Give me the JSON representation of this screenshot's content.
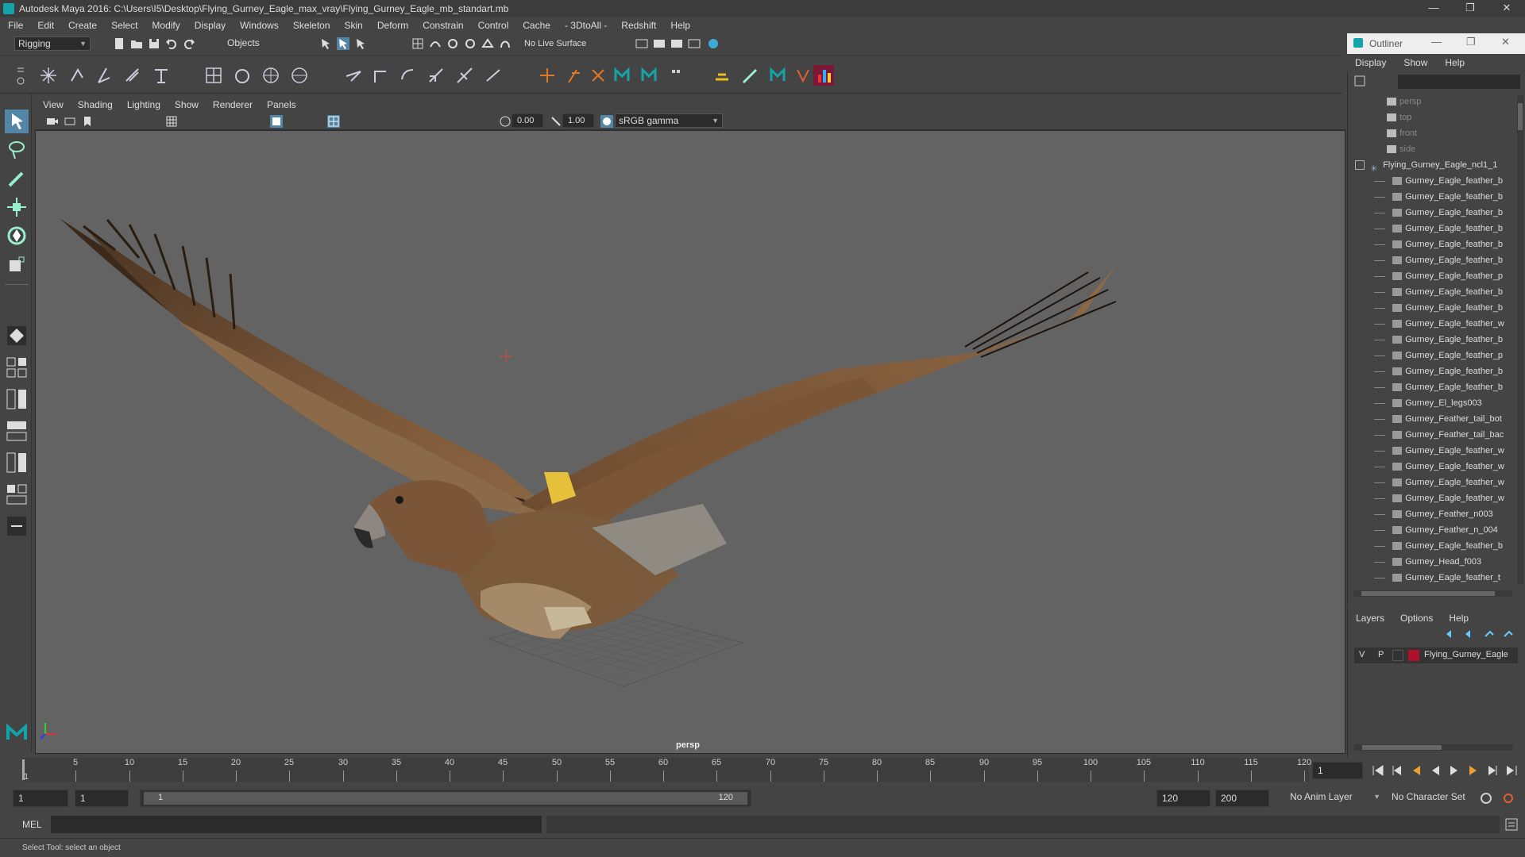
{
  "window": {
    "title": "Autodesk Maya 2016: C:\\Users\\I5\\Desktop\\Flying_Gurney_Eagle_max_vray\\Flying_Gurney_Eagle_mb_standart.mb",
    "minimize": "—",
    "restore": "❐",
    "close": "✕"
  },
  "menubar": [
    "File",
    "Edit",
    "Create",
    "Select",
    "Modify",
    "Display",
    "Windows",
    "Skeleton",
    "Skin",
    "Deform",
    "Constrain",
    "Control",
    "Cache",
    "- 3DtoAll -",
    "Redshift",
    "Help"
  ],
  "statusline": {
    "menuset": "Rigging",
    "selection_mode": "Objects",
    "live_surface": "No Live Surface"
  },
  "viewport": {
    "menus": [
      "View",
      "Shading",
      "Lighting",
      "Show",
      "Renderer",
      "Panels"
    ],
    "exposure": "0.00",
    "gamma": "1.00",
    "color_space": "sRGB gamma",
    "camera_label": "persp"
  },
  "timeline": {
    "ticks": [
      "5",
      "10",
      "15",
      "20",
      "25",
      "30",
      "35",
      "40",
      "45",
      "50",
      "55",
      "60",
      "65",
      "70",
      "75",
      "80",
      "85",
      "90",
      "95",
      "100",
      "105",
      "110",
      "115",
      "120"
    ],
    "first_tick": "1",
    "current_frame": "1"
  },
  "range": {
    "start": "1",
    "anim_start": "1",
    "slider_start": "1",
    "slider_end": "120",
    "end": "120",
    "anim_end": "200",
    "anim_layer": "No Anim Layer",
    "character_set": "No Character Set"
  },
  "cmdline": {
    "label": "MEL"
  },
  "helpline": {
    "text": "Select Tool: select an object"
  },
  "outliner": {
    "title": "Outliner",
    "menus": [
      "Display",
      "Show",
      "Help"
    ],
    "cameras": [
      "persp",
      "top",
      "front",
      "side"
    ],
    "group": "Flying_Gurney_Eagle_ncl1_1",
    "children": [
      "Gurney_Eagle_feather_b",
      "Gurney_Eagle_feather_b",
      "Gurney_Eagle_feather_b",
      "Gurney_Eagle_feather_b",
      "Gurney_Eagle_feather_b",
      "Gurney_Eagle_feather_b",
      "Gurney_Eagle_feather_p",
      "Gurney_Eagle_feather_b",
      "Gurney_Eagle_feather_b",
      "Gurney_Eagle_feather_w",
      "Gurney_Eagle_feather_b",
      "Gurney_Eagle_feather_p",
      "Gurney_Eagle_feather_b",
      "Gurney_Eagle_feather_b",
      "Gurney_El_legs003",
      "Gurney_Feather_tail_bot",
      "Gurney_Feather_tail_bac",
      "Gurney_Eagle_feather_w",
      "Gurney_Eagle_feather_w",
      "Gurney_Eagle_feather_w",
      "Gurney_Eagle_feather_w",
      "Gurney_Feather_n003",
      "Gurney_Feather_n_004",
      "Gurney_Eagle_feather_b",
      "Gurney_Head_f003",
      "Gurney_Eagle_feather_t"
    ]
  },
  "layers": {
    "menus": [
      "Layers",
      "Options",
      "Help"
    ],
    "rows": [
      {
        "v": "V",
        "p": "P",
        "name": "Flying_Gurney_Eagle",
        "color": "#b0102a"
      }
    ]
  },
  "colors": {
    "maya_teal": "#14a3a8",
    "accent_blue": "#5285a6",
    "viewport_bg": "#636363"
  },
  "icons": [
    "maya-logo-icon",
    "select-tool-icon",
    "lasso-icon",
    "paint-icon",
    "move-icon",
    "rotate-icon",
    "scale-icon",
    "camera-icon",
    "outliner-icon",
    "layer-icon"
  ]
}
